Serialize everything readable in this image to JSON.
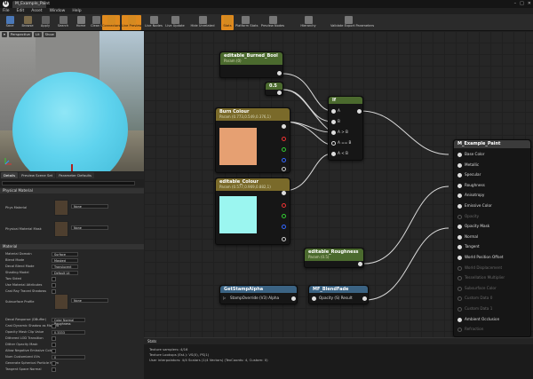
{
  "titlebar": {
    "tab_label": "M_Example_Paint"
  },
  "menu": [
    "File",
    "Edit",
    "Asset",
    "Window",
    "Help"
  ],
  "toolbar": [
    {
      "label": "Save",
      "color": "#4a78b8"
    },
    {
      "label": "Browse",
      "color": "#7a6a4a"
    },
    {
      "label": "Apply",
      "color": "#5f5f5f"
    },
    {
      "label": "Search",
      "color": "#6a6a6a"
    },
    {
      "label": "Home",
      "color": "#7a7a7a"
    },
    {
      "label": "Clean Up",
      "color": "#6e6e6e"
    },
    {
      "label": "Connectors",
      "color": "#d58a20"
    },
    {
      "label": "Live Preview",
      "color": "#d58a20"
    },
    {
      "label": "Live Nodes",
      "color": "#777777"
    },
    {
      "label": "Live Update",
      "color": "#777777"
    },
    {
      "label": "Hide Unrelated",
      "color": "#777777"
    },
    {
      "label": "Stats",
      "color": "#d58a20"
    },
    {
      "label": "Platform Stats",
      "color": "#777777"
    },
    {
      "label": "Preview Nodes",
      "color": "#777777"
    },
    {
      "label": "Hierarchy",
      "color": "#777777"
    },
    {
      "label": "Validate Export Parameters",
      "color": "#777777"
    }
  ],
  "viewport": {
    "chips": [
      "Perspective",
      "Lit",
      "Show"
    ]
  },
  "details": {
    "tabs": [
      "Details",
      "Preview Scene Set",
      "Parameter Defaults"
    ],
    "physical_section": "Physical Material",
    "phys_material_label": "Phys Material",
    "phys_material_value": "None",
    "phys_mask_label": "Physical Material Mask",
    "phys_mask_value": "None",
    "material_section": "Material",
    "rows": [
      {
        "label": "Material Domain",
        "value": "Surface"
      },
      {
        "label": "Blend Mode",
        "value": "Masked"
      },
      {
        "label": "Decal Blend Mode",
        "value": "Translucent"
      },
      {
        "label": "Shading Model",
        "value": "Default Lit"
      },
      {
        "label": "Two Sided",
        "check": true
      },
      {
        "label": "Use Material Attributes",
        "check": true
      },
      {
        "label": "Cast Ray Traced Shadows",
        "check": true
      }
    ],
    "subsurface_label": "Subsurface Profile",
    "subsurface_value": "None",
    "rows2": [
      {
        "label": "Decal Response (DBuffer)",
        "value": "Color Normal Roughness"
      },
      {
        "label": "Cast Dynamic Shadow as Masked",
        "check": true
      },
      {
        "label": "Opacity Mask Clip Value",
        "value": "0.3333"
      },
      {
        "label": "Dithered LOD Transition",
        "check": true
      },
      {
        "label": "Dither Opacity Mask",
        "check": true
      },
      {
        "label": "Allow Negative Emissive Color",
        "check": true
      },
      {
        "label": "Num Customized UVs",
        "value": "0"
      },
      {
        "label": "Generate Spherical Particle Norm",
        "check": true
      },
      {
        "label": "Tangent Space Normal",
        "check": true
      }
    ]
  },
  "graph": {
    "burned_bool": {
      "title": "editable_Burned_Bool",
      "sub": "Param (0)"
    },
    "constant": {
      "value": "0.5"
    },
    "if_node": {
      "title": "If",
      "pins": [
        "A",
        "B",
        "A > B",
        "A == B",
        "A < B"
      ]
    },
    "burn_colour": {
      "title": "Burn Colour",
      "sub": "Param (0.773,0.549,0.376,1)",
      "swatch": "#e6a072"
    },
    "editable_colour": {
      "title": "editable_Colour",
      "sub": "Param (0.577,0.969,0.882,1)",
      "swatch": "#9bf6f0"
    },
    "roughness": {
      "title": "editable_Roughness",
      "sub": "Param (0.5)"
    },
    "stamp_alpha": {
      "title": "GetStampAlpha",
      "pin": "StampOverride (V3) Alpha"
    },
    "blend_fade": {
      "title": "MF_BlendFade",
      "pin": "Opacity (S) Result"
    },
    "result": {
      "title": "M_Example_Paint",
      "pins": [
        {
          "label": "Base Color",
          "active": true
        },
        {
          "label": "Metallic",
          "active": true
        },
        {
          "label": "Specular",
          "active": true
        },
        {
          "label": "Roughness",
          "active": true
        },
        {
          "label": "Anisotropy",
          "active": true
        },
        {
          "label": "Emissive Color",
          "active": true
        },
        {
          "label": "Opacity",
          "active": false
        },
        {
          "label": "Opacity Mask",
          "active": true
        },
        {
          "label": "Normal",
          "active": true
        },
        {
          "label": "Tangent",
          "active": true
        },
        {
          "label": "World Position Offset",
          "active": true
        },
        {
          "label": "World Displacement",
          "active": false
        },
        {
          "label": "Tessellation Multiplier",
          "active": false
        },
        {
          "label": "Subsurface Color",
          "active": false
        },
        {
          "label": "Custom Data 0",
          "active": false
        },
        {
          "label": "Custom Data 1",
          "active": false
        },
        {
          "label": "Ambient Occlusion",
          "active": true
        },
        {
          "label": "Refraction",
          "active": false
        }
      ]
    }
  },
  "log": {
    "tab": "Stats",
    "lines": [
      "Texture samplers: 4/16",
      "Texture Lookups (Est.): VS(0), PS(1)",
      "User interpolators: 4/4 Scalars (1/4 Vectors) (TexCoords: 4, Custom: 0)"
    ]
  },
  "colors": {
    "accent": "#e08a1e",
    "param_header": "#4b6a2e",
    "vector_header": "#7a6a2a",
    "function_header": "#3b6383",
    "result_header": "#3b3b3b"
  }
}
